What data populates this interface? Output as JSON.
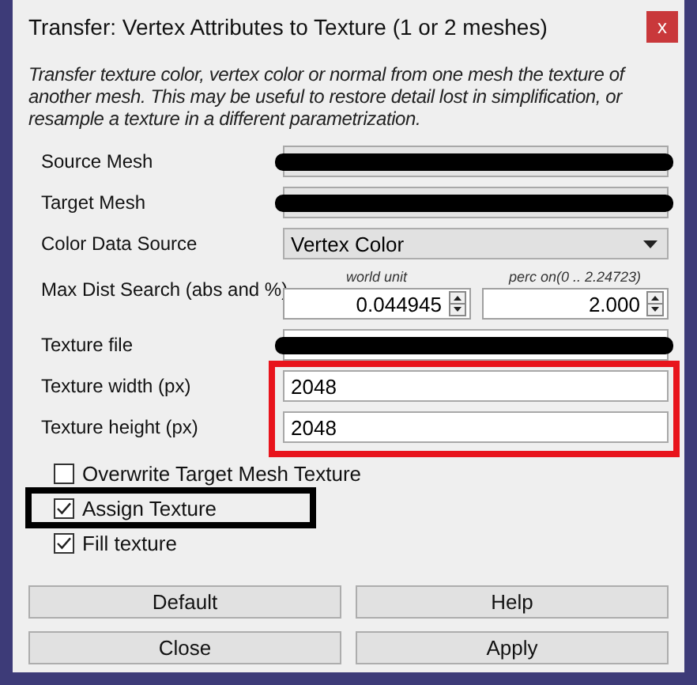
{
  "window": {
    "title": "Transfer: Vertex Attributes to Texture (1 or 2 meshes)",
    "close": "x"
  },
  "description": "Transfer texture color, vertex color or normal from one mesh the texture of another mesh. This may be useful to restore detail lost in simplification, or resample a texture in a different parametrization.",
  "rows": [
    {
      "kind": "text",
      "label": "Source Mesh",
      "disabled": true,
      "redacted": true
    },
    {
      "kind": "text",
      "label": "Target Mesh",
      "disabled": true,
      "redacted": true
    },
    {
      "kind": "combo",
      "label": "Color Data Source",
      "value": "Vertex Color"
    },
    {
      "kind": "spin-pair",
      "label": "Max Dist Search (abs and %)",
      "spins": [
        {
          "caption": "world unit",
          "value": "0.044945"
        },
        {
          "caption": "perc on(0 .. 2.24723)",
          "value": "2.000"
        }
      ]
    },
    {
      "kind": "text",
      "label": "Texture file",
      "disabled": false,
      "redacted": true
    },
    {
      "kind": "text",
      "label": "Texture width (px)",
      "value": "2048",
      "disabled": false,
      "redacted": false,
      "highlighted": true
    },
    {
      "kind": "text",
      "label": "Texture height (px)",
      "value": "2048",
      "disabled": false,
      "redacted": false,
      "highlighted": true
    }
  ],
  "checkboxes": [
    {
      "label": "Overwrite Target Mesh Texture",
      "checked": false,
      "highlighted": false
    },
    {
      "label": "Assign Texture",
      "checked": true,
      "highlighted": true
    },
    {
      "label": "Fill texture",
      "checked": true,
      "highlighted": false
    }
  ],
  "buttons": [
    "Default",
    "Help",
    "Close",
    "Apply"
  ]
}
